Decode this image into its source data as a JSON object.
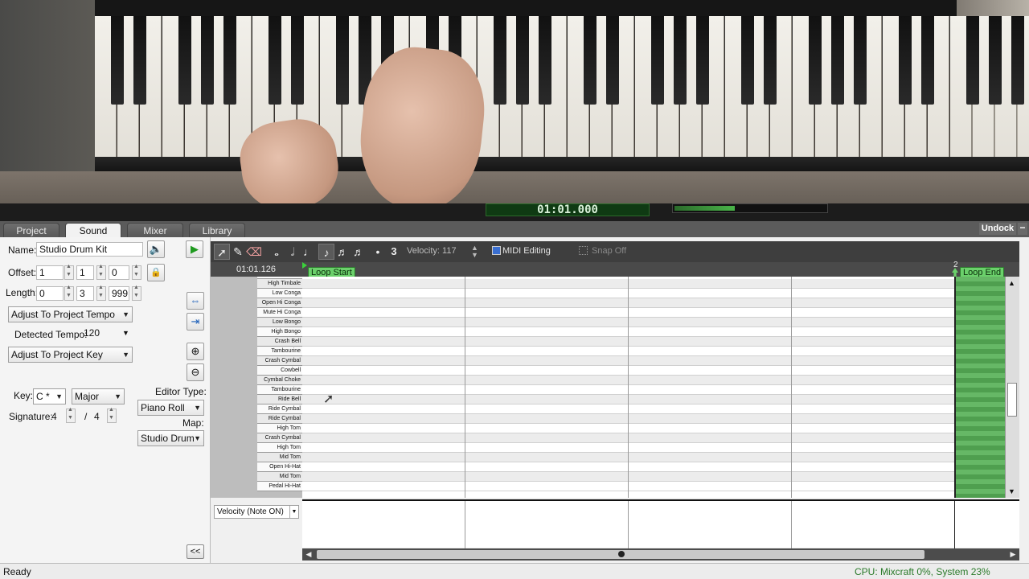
{
  "tabs": [
    {
      "label": "Project",
      "active": false
    },
    {
      "label": "Sound",
      "active": true
    },
    {
      "label": "Mixer",
      "active": false
    },
    {
      "label": "Library",
      "active": false
    }
  ],
  "undock_label": "Undock",
  "sound_panel": {
    "name_label": "Name:",
    "name_value": "Studio Drum Kit",
    "offset_label": "Offset:",
    "offset_values": [
      "1",
      "1",
      "0"
    ],
    "length_label": "Length:",
    "length_values": [
      "0",
      "3",
      "999"
    ],
    "tempo_mode": "Adjust To Project Tempo",
    "detected_tempo_label": "Detected Tempo:",
    "detected_tempo_value": "120",
    "key_mode": "Adjust To Project Key",
    "key_label": "Key:",
    "key_value": "C *",
    "scale_value": "Major",
    "signature_label": "Signature:",
    "signature_numerator": "4",
    "signature_slash": "/",
    "signature_denominator": "4",
    "editor_type_label": "Editor Type:",
    "editor_type_value": "Piano Roll",
    "map_label": "Map:",
    "map_value": "Studio Drum"
  },
  "toolbar": {
    "tuplet": "3",
    "velocity_label": "Velocity: 117",
    "midi_editing_label": "MIDI Editing",
    "snap_label": "Snap Off"
  },
  "ruler": {
    "position": "01:01.126",
    "bar_marker": "2",
    "loop_start": "Loop Start",
    "loop_end": "Loop End"
  },
  "drum_rows": [
    "High Timbale",
    "Low Conga",
    "Open Hi Conga",
    "Mute Hi Conga",
    "Low Bongo",
    "High Bongo",
    "Crash Bell",
    "Tambourine",
    "Crash Cymbal",
    "Cowbell",
    "Cymbal Choke",
    "Tambourine",
    "Ride Bell",
    "Ride Cymbal",
    "Ride Cymbal",
    "High Tom",
    "Crash Cymbal",
    "High Tom",
    "Mid Tom",
    "Open Hi-Hat",
    "Mid Tom",
    "Pedal Hi-Hat"
  ],
  "velocity_selector": "Velocity (Note ON)",
  "collapse_label": "<<",
  "status": {
    "left": "Ready",
    "right": "CPU: Mixcraft 0%, System 23%"
  },
  "webcam_timer": "01:01.000",
  "colors": {
    "loop_green": "#6bd06b",
    "status_green": "#2a7a2a",
    "toolbar_dark": "#3e3e3e"
  }
}
